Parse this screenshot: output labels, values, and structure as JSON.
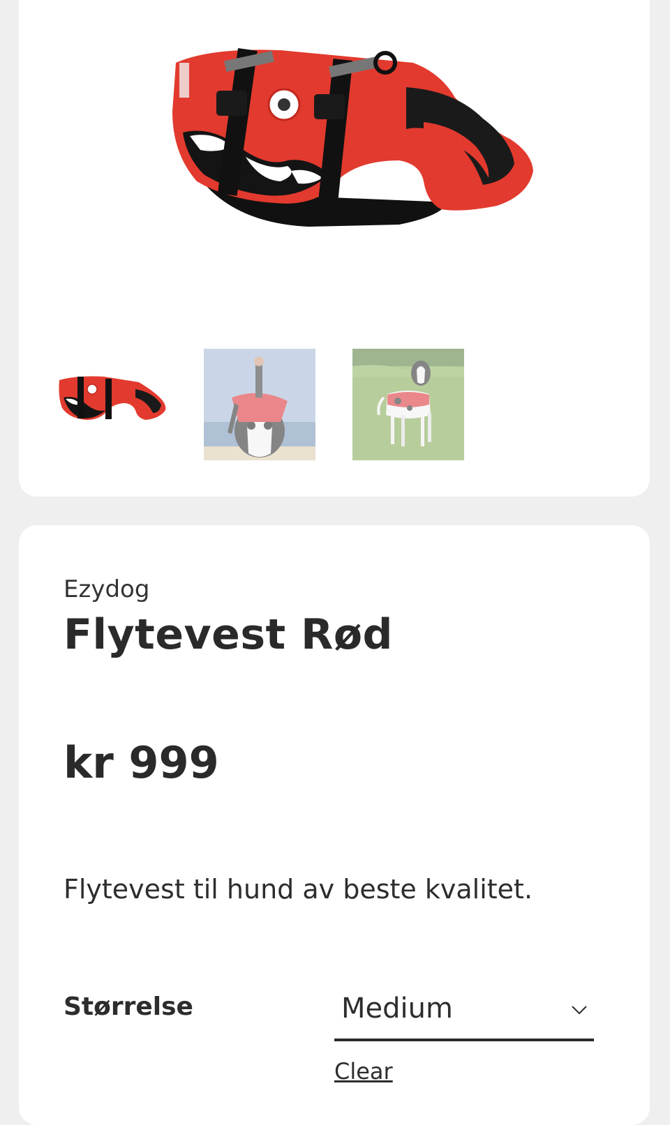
{
  "gallery": {
    "main_image": "life-vest-red-product-photo",
    "thumbnails": [
      {
        "name": "life-vest-red-thumbnail",
        "selected": true
      },
      {
        "name": "dog-on-paddleboard-thumbnail",
        "selected": false
      },
      {
        "name": "dog-in-grass-thumbnail",
        "selected": false
      }
    ]
  },
  "product": {
    "brand": "Ezydog",
    "title": "Flytevest Rød",
    "price": "kr 999",
    "description": "Flytevest til hund av beste kvalitet."
  },
  "options": {
    "size_label": "Størrelse",
    "size_value": "Medium",
    "clear_label": "Clear"
  },
  "colors": {
    "background": "#efefef",
    "card": "#ffffff",
    "vest_red": "#e23a2e",
    "text": "#2b2b2b"
  }
}
